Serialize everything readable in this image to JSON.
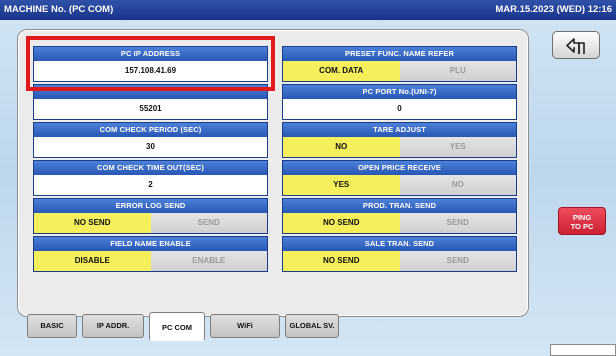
{
  "title_bar": {
    "title": "MACHINE No. (PC COM)",
    "datetime": "MAR.15.2023 (WED) 12:16"
  },
  "left_column": {
    "pc_ip_address": {
      "label": "PC IP ADDRESS",
      "value": "157.108.41.69"
    },
    "port": {
      "label": "",
      "value": "55201"
    },
    "com_check_period": {
      "label": "COM CHECK PERIOD (SEC)",
      "value": "30"
    },
    "com_check_timeout": {
      "label": "COM CHECK TIME OUT(SEC)",
      "value": "2"
    },
    "error_log_send": {
      "label": "ERROR LOG SEND",
      "options": [
        "NO SEND",
        "SEND"
      ],
      "selected": "NO SEND"
    },
    "field_name_enable": {
      "label": "FIELD NAME ENABLE",
      "options": [
        "DISABLE",
        "ENABLE"
      ],
      "selected": "DISABLE"
    }
  },
  "right_column": {
    "preset_func_name_refer": {
      "label": "PRESET FUNC. NAME REFER",
      "options": [
        "COM. DATA",
        "PLU"
      ],
      "selected": "COM. DATA"
    },
    "pc_port_uni7": {
      "label": "PC PORT No.(UNI-7)",
      "value": "0"
    },
    "tare_adjust": {
      "label": "TARE ADJUST",
      "options": [
        "NO",
        "YES"
      ],
      "selected": "NO"
    },
    "open_price_receive": {
      "label": "OPEN PRICE RECEIVE",
      "options": [
        "YES",
        "NO"
      ],
      "selected": "YES"
    },
    "prod_tran_send": {
      "label": "PROD. TRAN. SEND",
      "options": [
        "NO SEND",
        "SEND"
      ],
      "selected": "NO SEND"
    },
    "sale_tran_send": {
      "label": "SALE TRAN. SEND",
      "options": [
        "NO SEND",
        "SEND"
      ],
      "selected": "NO SEND"
    }
  },
  "tabs": [
    {
      "label": "BASIC",
      "active": false
    },
    {
      "label": "IP ADDR.",
      "active": false
    },
    {
      "label": "PC COM",
      "active": true
    },
    {
      "label": "WiFi",
      "active": false
    },
    {
      "label": "GLOBAL SV.",
      "active": false
    }
  ],
  "buttons": {
    "back_icon": "return-arrow-icon",
    "ping_line1": "PING",
    "ping_line2": "TO PC"
  },
  "colors": {
    "header_blue": "#2856b4",
    "selected_yellow": "#f4ef5a",
    "ping_red": "#cc2233",
    "highlight_red": "#e01a1a"
  }
}
